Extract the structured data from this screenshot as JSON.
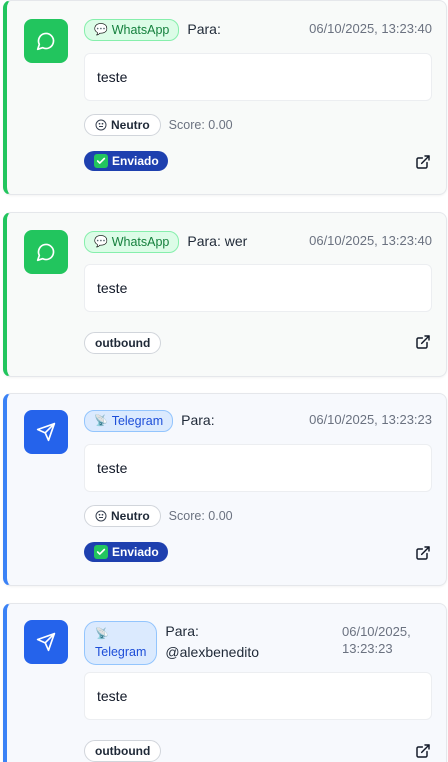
{
  "colors": {
    "whatsapp_accent": "#22c55e",
    "telegram_accent": "#2563eb",
    "sent_badge": "#1e40af"
  },
  "messages": [
    {
      "channel": "whatsapp",
      "channel_label": "WhatsApp",
      "channel_icon": "speech-bubble",
      "recipient": "Para:",
      "timestamp": "06/10/2025, 13:23:40",
      "content": "teste",
      "sentiment": "Neutro",
      "score": "Score: 0.00",
      "status": "Enviado"
    },
    {
      "channel": "whatsapp",
      "channel_label": "WhatsApp",
      "channel_icon": "speech-bubble",
      "recipient": "Para: wer",
      "timestamp": "06/10/2025, 13:23:40",
      "content": "teste",
      "direction": "outbound"
    },
    {
      "channel": "telegram",
      "channel_label": "Telegram",
      "channel_icon": "satellite",
      "recipient": "Para:",
      "timestamp": "06/10/2025, 13:23:23",
      "content": "teste",
      "sentiment": "Neutro",
      "score": "Score: 0.00",
      "status": "Enviado"
    },
    {
      "channel": "telegram",
      "channel_label": "Telegram",
      "channel_icon": "satellite",
      "recipient_prefix": "Para:",
      "recipient_name": "@alexbenedito",
      "timestamp_date": "06/10/2025,",
      "timestamp_time": "13:23:23",
      "content": "teste",
      "direction": "outbound"
    }
  ]
}
